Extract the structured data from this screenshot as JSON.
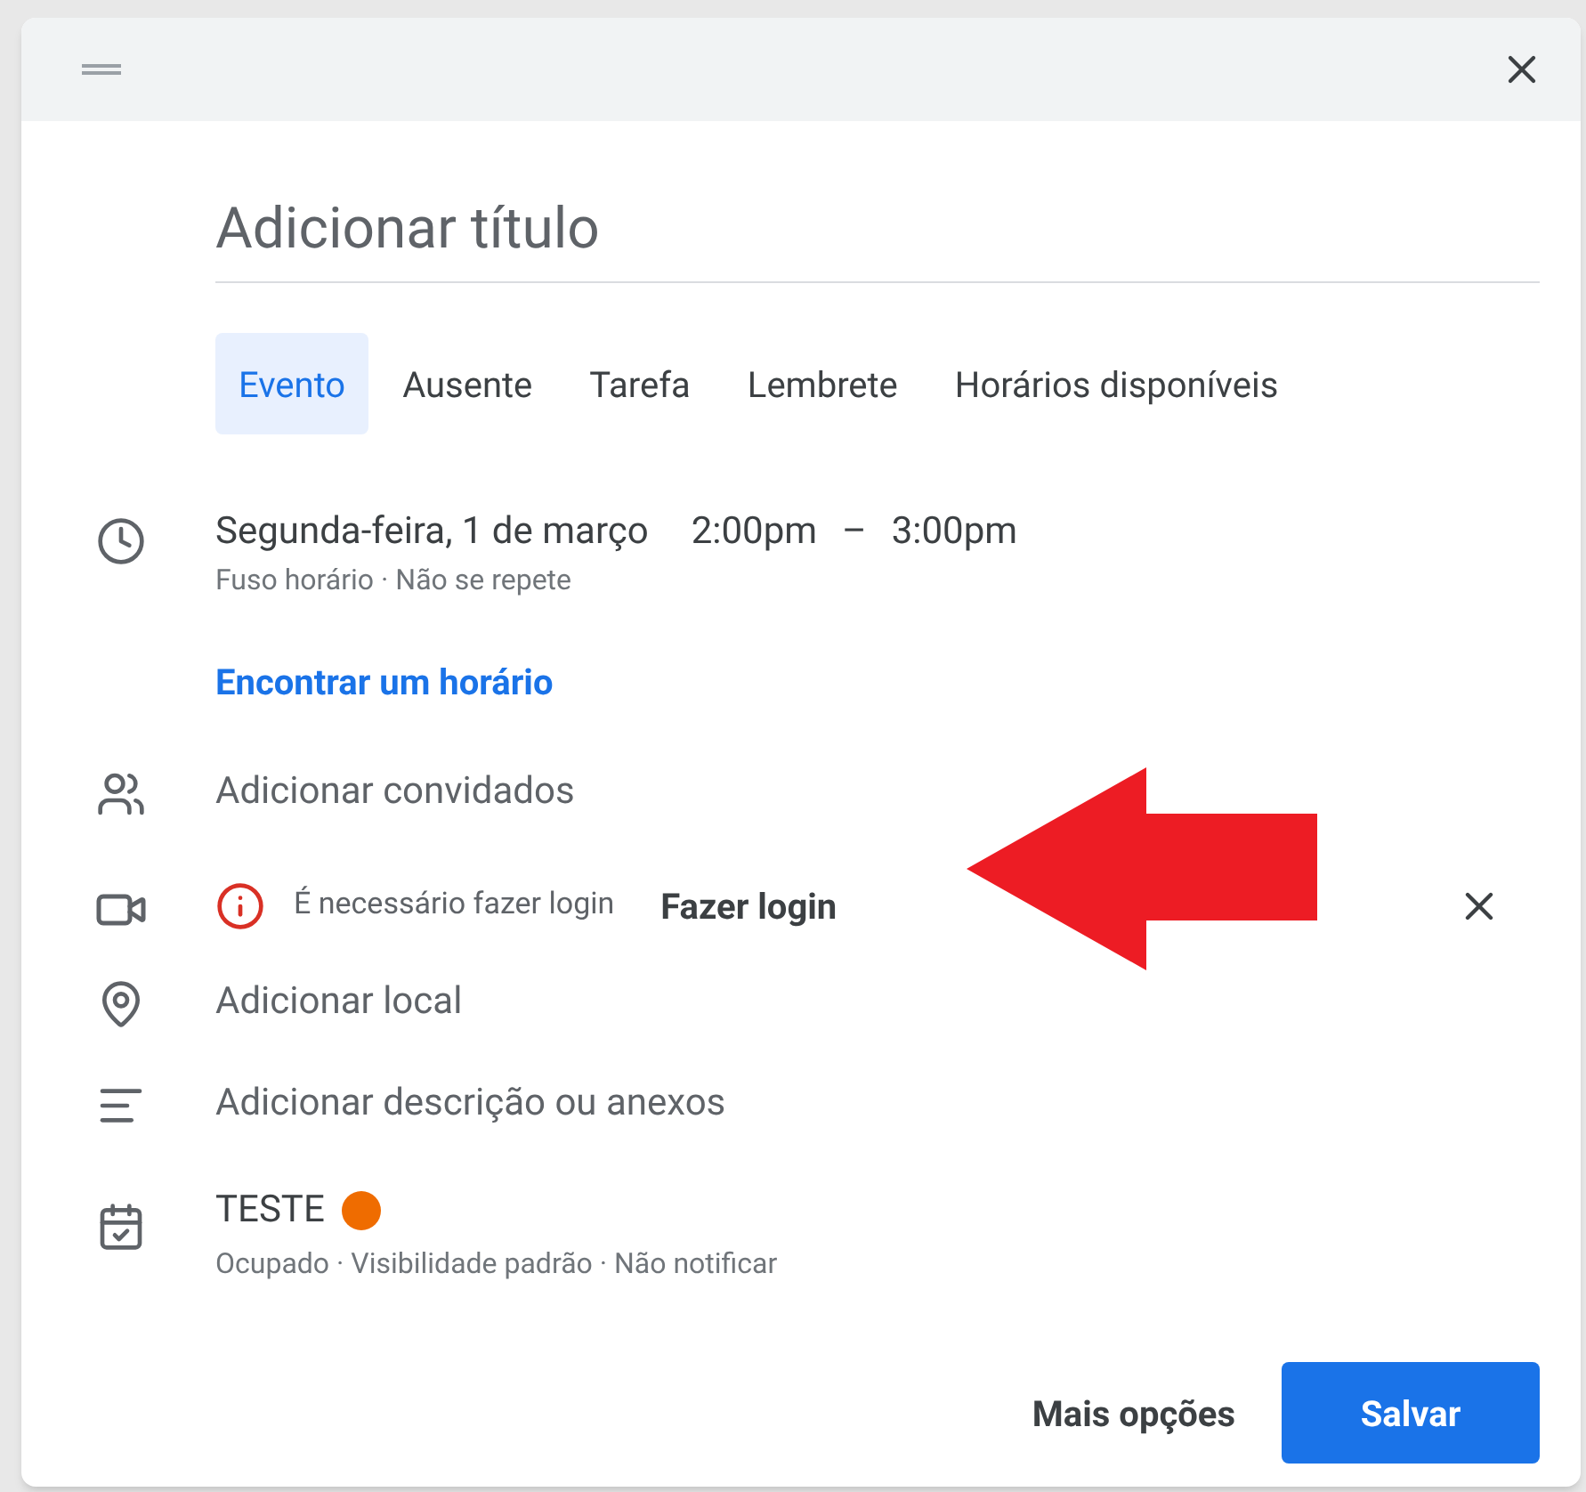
{
  "title": {
    "placeholder": "Adicionar título"
  },
  "tabs": [
    {
      "label": "Evento",
      "selected": true
    },
    {
      "label": "Ausente",
      "selected": false
    },
    {
      "label": "Tarefa",
      "selected": false
    },
    {
      "label": "Lembrete",
      "selected": false
    },
    {
      "label": "Horários disponíveis",
      "selected": false
    }
  ],
  "datetime": {
    "date": "Segunda-feira, 1 de março",
    "start": "2:00pm",
    "separator": "–",
    "end": "3:00pm",
    "details": "Fuso horário · Não se repete"
  },
  "find_time_link": "Encontrar um horário",
  "guests": "Adicionar convidados",
  "conference": {
    "warning": "É necessário fazer login",
    "action": "Fazer login"
  },
  "location": "Adicionar local",
  "description": "Adicionar descrição ou anexos",
  "calendar": {
    "name": "TESTE",
    "color": "#ef6c00",
    "details": "Ocupado · Visibilidade padrão · Não notificar"
  },
  "buttons": {
    "more": "Mais opções",
    "save": "Salvar"
  }
}
